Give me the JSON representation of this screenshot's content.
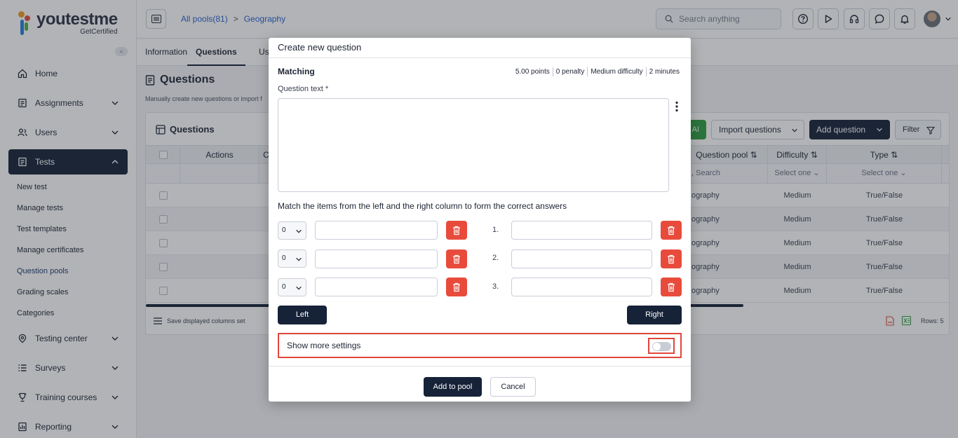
{
  "brand": {
    "name_a": "youtest",
    "name_b": "me",
    "tagline": "GetCertified",
    "collapse_glyph": "«"
  },
  "sidebar": {
    "items": [
      {
        "label": "Home",
        "icon": "home-icon"
      },
      {
        "label": "Assignments",
        "icon": "assignment-icon"
      },
      {
        "label": "Users",
        "icon": "users-icon"
      },
      {
        "label": "Tests",
        "icon": "tests-icon",
        "active": true
      }
    ],
    "test_subitems": [
      "New test",
      "Manage tests",
      "Test templates",
      "Manage certificates",
      "Question pools",
      "Grading scales",
      "Categories"
    ],
    "items_after": [
      {
        "label": "Testing center",
        "icon": "testing-center-icon"
      },
      {
        "label": "Surveys",
        "icon": "surveys-icon"
      },
      {
        "label": "Training courses",
        "icon": "training-icon"
      },
      {
        "label": "Reporting",
        "icon": "reporting-icon"
      }
    ]
  },
  "header": {
    "breadcrumb_root": "All pools(81)",
    "breadcrumb_sep": ">",
    "breadcrumb_current": "Geography",
    "search_placeholder": "Search anything"
  },
  "tabs": [
    "Information",
    "Questions",
    "Us"
  ],
  "page": {
    "title": "Questions",
    "description": "Manually create new questions or import f"
  },
  "card": {
    "title": "Questions",
    "ai_label": "AI",
    "import_label": "Import questions",
    "add_label": "Add question",
    "filter_label": "Filter",
    "columns": {
      "actions": "Actions",
      "c": "C",
      "pool": "Question pool",
      "difficulty": "Difficulty",
      "type": "Type"
    },
    "filters": {
      "pool": ", Search",
      "difficulty": "Select one",
      "type": "Select one"
    },
    "rows": [
      {
        "pool": "ography",
        "difficulty": "Medium",
        "type": "True/False"
      },
      {
        "pool": "ography",
        "difficulty": "Medium",
        "type": "True/False"
      },
      {
        "pool": "ography",
        "difficulty": "Medium",
        "type": "True/False"
      },
      {
        "pool": "ography",
        "difficulty": "Medium",
        "type": "True/False"
      },
      {
        "pool": "ography",
        "difficulty": "Medium",
        "type": "True/False"
      }
    ],
    "footer_text": "Save displayed columns set",
    "rows_label": "Rows: 5"
  },
  "modal": {
    "title": "Create new question",
    "question_type": "Matching",
    "meta": [
      "5.00 points",
      "0 penalty",
      "Medium difficulty",
      "2 minutes"
    ],
    "question_text_label": "Question text *",
    "match_instruction": "Match the items from the left and the right column to form the correct answers",
    "pairs": [
      {
        "select": "0",
        "left_value": "",
        "num": "1.",
        "right_value": ""
      },
      {
        "select": "0",
        "left_value": "",
        "num": "2.",
        "right_value": ""
      },
      {
        "select": "0",
        "left_value": "",
        "num": "3.",
        "right_value": ""
      }
    ],
    "left_label": "Left",
    "right_label": "Right",
    "more_settings_label": "Show more settings",
    "more_settings_on": false,
    "add_to_pool_label": "Add to pool",
    "cancel_label": "Cancel"
  },
  "colors": {
    "primary": "#152238",
    "danger": "#e84b3c",
    "accent": "#2a62d0",
    "success": "#2e9e42"
  }
}
